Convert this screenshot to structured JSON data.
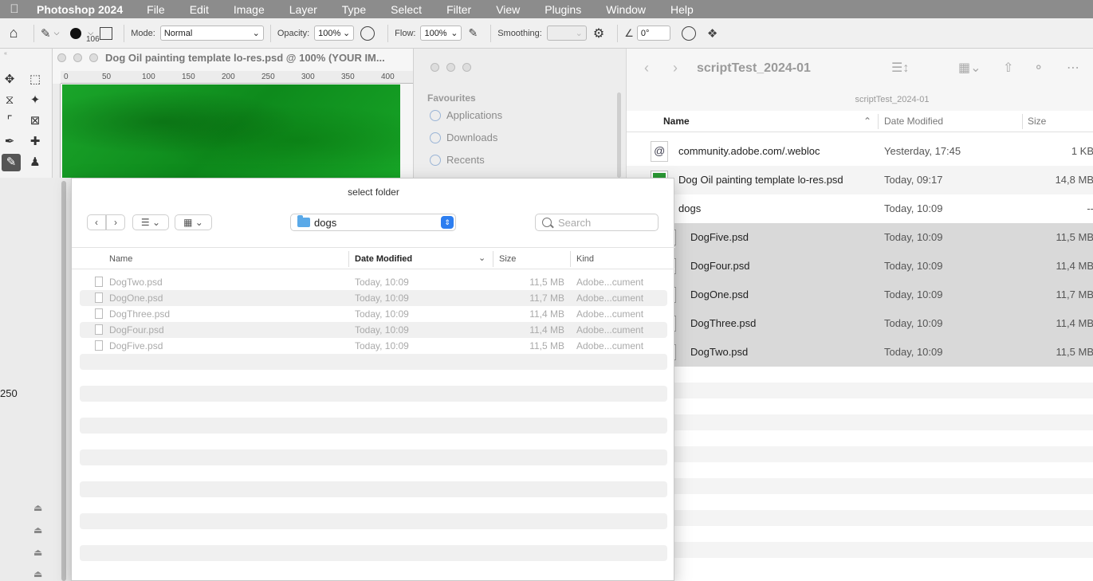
{
  "menubar": {
    "app_name": "Photoshop 2024",
    "menus": [
      "File",
      "Edit",
      "Image",
      "Layer",
      "Type",
      "Select",
      "Filter",
      "View",
      "Plugins",
      "Window",
      "Help"
    ]
  },
  "options_bar": {
    "brush_size": "106",
    "mode_label": "Mode:",
    "mode_value": "Normal",
    "opacity_label": "Opacity:",
    "opacity_value": "100%",
    "flow_label": "Flow:",
    "flow_value": "100%",
    "smoothing_label": "Smoothing:",
    "smoothing_value": "",
    "angle_value": "0°"
  },
  "ps_document": {
    "title": "Dog Oil painting template lo-res.psd @ 100% (YOUR IM...",
    "ruler_ticks": [
      "0",
      "50",
      "100",
      "150",
      "200",
      "250",
      "300",
      "350",
      "400"
    ]
  },
  "finder_sidebar": {
    "section": "Favourites",
    "items": [
      "Applications",
      "Downloads",
      "Recents"
    ]
  },
  "finder_main": {
    "title": "scriptTest_2024-01",
    "path": "scriptTest_2024-01",
    "columns": {
      "name": "Name",
      "date": "Date Modified",
      "size": "Size"
    },
    "rows": [
      {
        "name": "community.adobe.com/.webloc",
        "date": "Yesterday, 17:45",
        "size": "1 KB"
      },
      {
        "name": "Dog Oil painting template lo-res.psd",
        "date": "Today, 09:17",
        "size": "14,8 MB"
      },
      {
        "name": "dogs",
        "date": "Today, 10:09",
        "size": "--"
      },
      {
        "name": "DogFive.psd",
        "date": "Today, 10:09",
        "size": "11,5 MB"
      },
      {
        "name": "DogFour.psd",
        "date": "Today, 10:09",
        "size": "11,4 MB"
      },
      {
        "name": "DogOne.psd",
        "date": "Today, 10:09",
        "size": "11,7 MB"
      },
      {
        "name": "DogThree.psd",
        "date": "Today, 10:09",
        "size": "11,4 MB"
      },
      {
        "name": "DogTwo.psd",
        "date": "Today, 10:09",
        "size": "11,5 MB"
      }
    ]
  },
  "left_panel": {
    "value": "250"
  },
  "dialog": {
    "title": "select folder",
    "folder": "dogs",
    "search_placeholder": "Search",
    "columns": {
      "name": "Name",
      "date": "Date Modified",
      "size": "Size",
      "kind": "Kind"
    },
    "rows": [
      {
        "name": "DogTwo.psd",
        "date": "Today, 10:09",
        "size": "11,5 MB",
        "kind": "Adobe...cument"
      },
      {
        "name": "DogOne.psd",
        "date": "Today, 10:09",
        "size": "11,7 MB",
        "kind": "Adobe...cument"
      },
      {
        "name": "DogThree.psd",
        "date": "Today, 10:09",
        "size": "11,4 MB",
        "kind": "Adobe...cument"
      },
      {
        "name": "DogFour.psd",
        "date": "Today, 10:09",
        "size": "11,4 MB",
        "kind": "Adobe...cument"
      },
      {
        "name": "DogFive.psd",
        "date": "Today, 10:09",
        "size": "11,5 MB",
        "kind": "Adobe...cument"
      }
    ]
  }
}
